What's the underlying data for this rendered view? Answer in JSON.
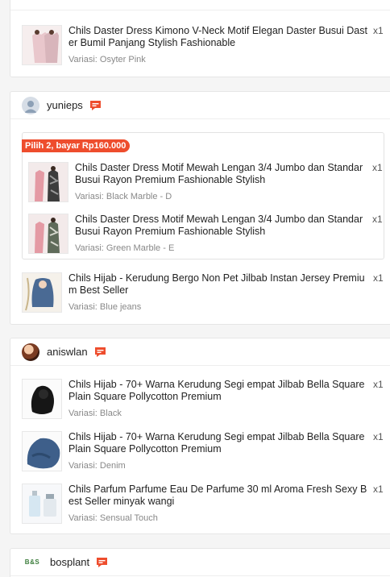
{
  "shops": [
    {
      "name": "",
      "items": [
        {
          "title": "Chils Daster Dress Kimono V-Neck Motif Elegan Daster Busui Daster Bumil Panjang Stylish Fashionable",
          "variant": "Variasi: Osyter Pink",
          "qty": "x1"
        }
      ]
    },
    {
      "name": "yunieps",
      "bundle": {
        "tag": "Pilih 2, bayar Rp160.000",
        "items": [
          {
            "title": "Chils Daster Dress Motif Mewah Lengan 3/4 Jumbo dan Standar Busui Rayon Premium Fashionable Stylish",
            "variant": "Variasi: Black Marble - D",
            "qty": "x1"
          },
          {
            "title": "Chils Daster Dress Motif Mewah Lengan 3/4 Jumbo dan Standar Busui Rayon Premium Fashionable Stylish",
            "variant": "Variasi: Green Marble - E",
            "qty": "x1"
          }
        ]
      },
      "items": [
        {
          "title": "Chils Hijab - Kerudung Bergo Non Pet Jilbab Instan Jersey Premium Best Seller",
          "variant": "Variasi: Blue jeans",
          "qty": "x1"
        }
      ]
    },
    {
      "name": "aniswlan",
      "items": [
        {
          "title": "Chils Hijab - 70+ Warna Kerudung Segi empat Jilbab Bella Square Plain Square Pollycotton Premium",
          "variant": "Variasi: Black",
          "qty": "x1"
        },
        {
          "title": "Chils Hijab - 70+ Warna Kerudung Segi empat Jilbab Bella Square Plain Square Pollycotton Premium",
          "variant": "Variasi: Denim",
          "qty": "x1"
        },
        {
          "title": "Chils Parfum Parfume Eau De Parfume 30 ml Aroma Fresh Sexy Best Seller minyak wangi",
          "variant": "Variasi: Sensual Touch",
          "qty": "x1"
        }
      ]
    },
    {
      "name": "bosplant",
      "logo_text": "B&S",
      "items": []
    }
  ],
  "colors": {
    "accent": "#ee4d2d",
    "chat_icon": "#ee4d2d"
  },
  "icons": {
    "chat": "chat-bubble-icon",
    "default_avatar": "user-avatar-icon"
  }
}
